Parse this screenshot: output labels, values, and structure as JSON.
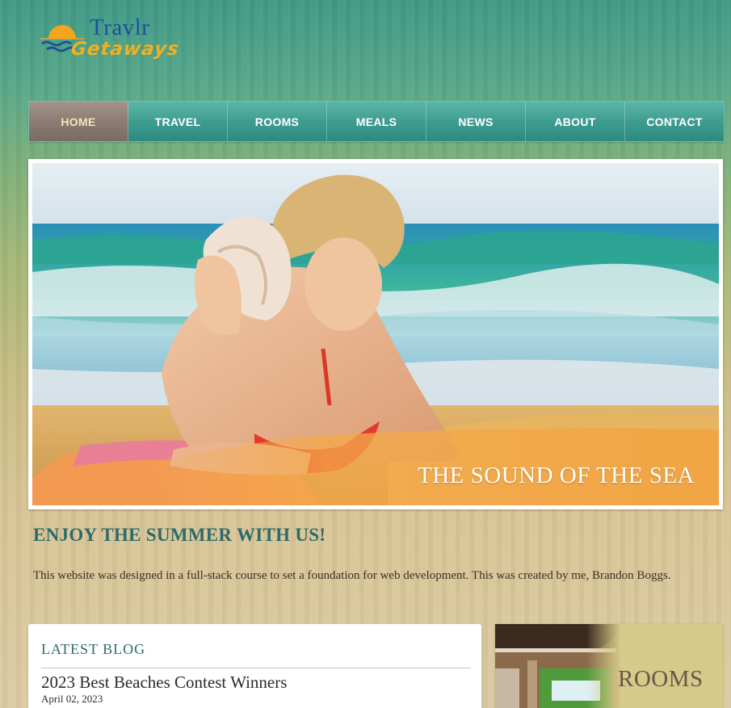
{
  "logo": {
    "title": "Travlr",
    "subtitle": "Getaways",
    "icon": "sun-over-waves-icon"
  },
  "nav": {
    "items": [
      {
        "label": "HOME",
        "active": true
      },
      {
        "label": "TRAVEL",
        "active": false
      },
      {
        "label": "ROOMS",
        "active": false
      },
      {
        "label": "MEALS",
        "active": false
      },
      {
        "label": "NEWS",
        "active": false
      },
      {
        "label": "ABOUT",
        "active": false
      },
      {
        "label": "CONTACT",
        "active": false
      }
    ]
  },
  "hero": {
    "caption": "THE SOUND OF THE SEA"
  },
  "intro": {
    "title": "ENJOY THE SUMMER WITH US!",
    "text": "This website was designed in a full-stack course to set a foundation for web development. This was created by me, Brandon Boggs."
  },
  "blog": {
    "heading": "LATEST BLOG",
    "post_title": "2023 Best Beaches Contest Winners",
    "post_date": "April 02, 2023"
  },
  "rooms": {
    "label": "ROOMS"
  },
  "colors": {
    "nav_teal": "#3f9d90",
    "nav_active": "#8c7c73",
    "heading_teal": "#2d6b6a",
    "logo_blue": "#1f4f9a",
    "logo_gold": "#f0b021"
  }
}
